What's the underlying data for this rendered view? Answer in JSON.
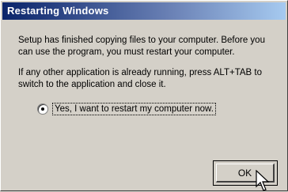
{
  "dialog": {
    "title": "Restarting Windows",
    "message1": "Setup has finished copying files to your computer.  Before you can use the program, you must restart your computer.",
    "message2": "If any other application is already running, press ALT+TAB to switch to the application and close it.",
    "restart_option": {
      "label": "Yes, I want to restart my computer now.",
      "selected": true
    },
    "ok_label": "OK"
  },
  "colors": {
    "title_start": "#0a246a",
    "title_end": "#a6caf0",
    "face": "#d4d0c8"
  },
  "icons": {
    "pointer": "mouse-pointer-icon"
  }
}
